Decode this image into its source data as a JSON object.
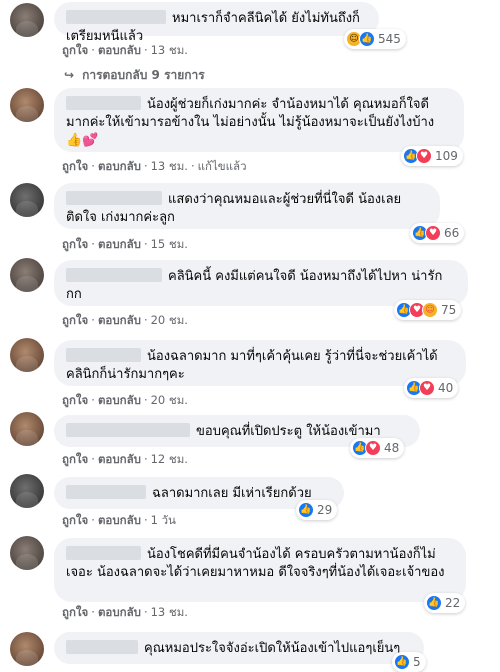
{
  "actions": {
    "like": "ถูกใจ",
    "reply": "ตอบกลับ",
    "dot": "·",
    "edited": "แก้ไขแล้ว"
  },
  "replies_link": {
    "arrow": "↪",
    "label": "การตอบกลับ 9 รายการ"
  },
  "comments": [
    {
      "text": "หมาเราก็จำคลีนิคได้ ยังไม่ทันถึงก็เตรียมหนีแล้ว",
      "time": "13 ชม.",
      "reactions": [
        "haha",
        "like"
      ],
      "count": "545"
    },
    {
      "text": "น้องผู้ช่วยก็เก่งมากค่ะ จำน้องหมาได้ คุณหมอก็ใจดี มากค่ะให้เข้ามารอข้างใน ไม่อย่างนั้น ไม่รู้น้องหมาจะเป็นยังไงบ้าง 👍💕",
      "time": "13 ชม.",
      "reactions": [
        "like",
        "love"
      ],
      "count": "109"
    },
    {
      "text": "แสดงว่าคุณหมอและผู้ช่วยที่นี่ใจดี น้องเลย ติดใจ เก่งมากค่ะลูก",
      "time": "15 ชม.",
      "reactions": [
        "like",
        "love"
      ],
      "count": "66"
    },
    {
      "text": "คลินิคนี้ คงมีแต่คนใจดี น้องหมาถึงได้ไปหา น่ารักกก",
      "time": "20 ชม.",
      "reactions": [
        "like",
        "love",
        "care"
      ],
      "count": "75"
    },
    {
      "text": "น้องฉลาดมาก มาที่ๆเค้าคุ้นเคย รู้ว่าที่นี่จะช่วยเค้าได้ คลินิกก็น่ารักมากๆคะ",
      "time": "20 ชม.",
      "reactions": [
        "like",
        "love"
      ],
      "count": "40"
    },
    {
      "text": "ขอบคุณที่เปิดประตู ให้น้องเข้ามา",
      "time": "12 ชม.",
      "reactions": [
        "like",
        "love"
      ],
      "count": "48"
    },
    {
      "text": "ฉลาดมากเลย มีเห่าเรียกด้วย",
      "time": "1 วัน",
      "reactions": [
        "like"
      ],
      "count": "29"
    },
    {
      "text": "น้องโชคดีที่มีคนจำน้องได้ ครอบครัวตามหาน้องก็ไม่เจอะ น้องฉลาดจะได้ว่าเคยมาหาหมอ ดีใจจริงๆที่น้องได้เจอะเจ้าของ",
      "time": "13 ชม.",
      "reactions": [
        "like"
      ],
      "count": "22"
    },
    {
      "text": "คุณหมอประใจจังอ่ะเปิดให้น้องเข้าไปแอๆเย็นๆ",
      "time": "",
      "reactions": [
        "like"
      ],
      "count": "5"
    }
  ],
  "colors": {
    "like": "#1877f2",
    "love": "#f33e58",
    "haha": "#f7b125",
    "bubble": "#f0f2f5",
    "meta": "#65676b"
  },
  "icons": {
    "like": "thumbs-up-icon",
    "love": "heart-icon",
    "haha": "laughing-face-icon",
    "care": "care-face-icon",
    "reply_arrow": "reply-arrow-icon"
  }
}
